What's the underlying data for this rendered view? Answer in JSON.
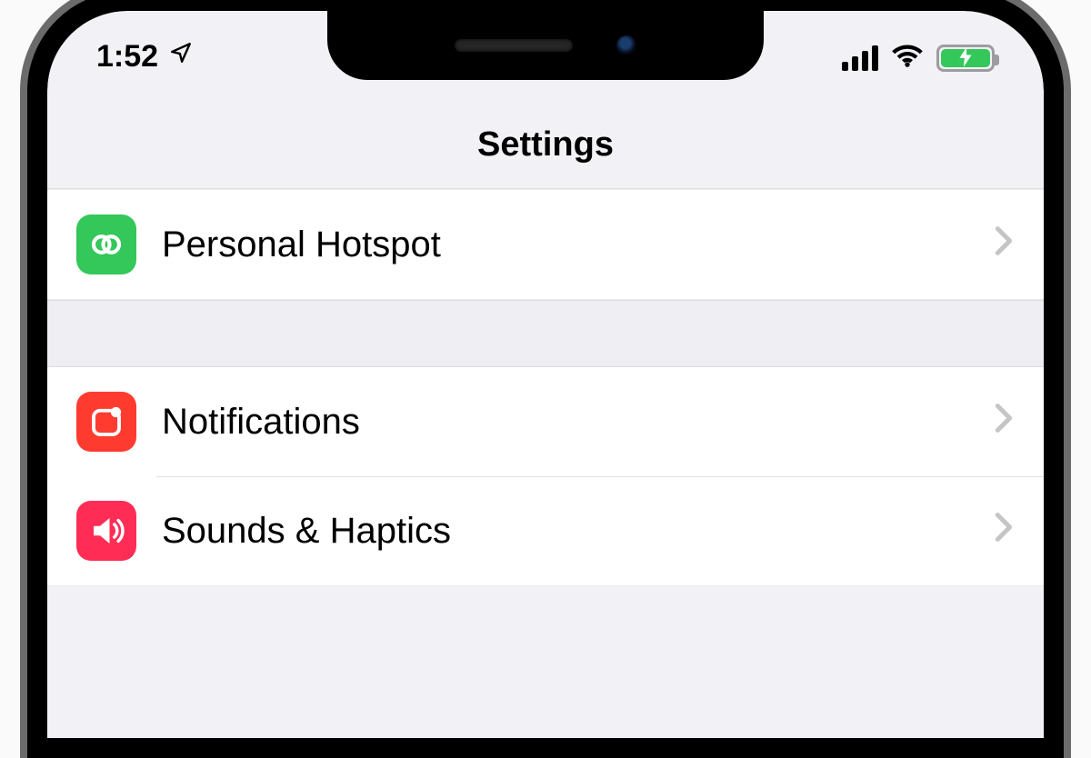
{
  "statusbar": {
    "time": "1:52",
    "location_services_on": true
  },
  "navbar": {
    "title": "Settings"
  },
  "rows": {
    "hotspot": {
      "label": "Personal Hotspot"
    },
    "notifications": {
      "label": "Notifications"
    },
    "sounds": {
      "label": "Sounds & Haptics"
    }
  }
}
